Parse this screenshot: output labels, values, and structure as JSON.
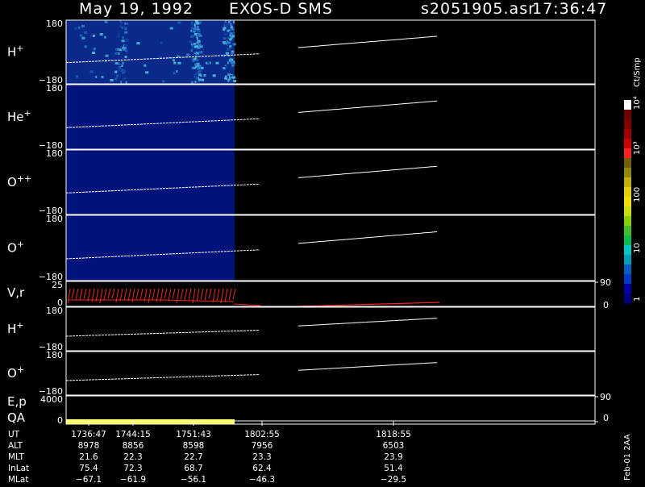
{
  "header": {
    "date": "May 19, 1992",
    "instrument": "EXOS-D SMS",
    "file": "s2051905.asr",
    "time": "17:36:47"
  },
  "colorbar": {
    "unit": "Ct/Smp",
    "tick_labels": [
      "1",
      "10",
      "100",
      "10³",
      "10⁴"
    ],
    "colors": [
      "#000080",
      "#0000a8",
      "#0038c8",
      "#0060c0",
      "#00a0b8",
      "#00c8c8",
      "#00c050",
      "#40c020",
      "#88d000",
      "#c8e000",
      "#f0e000",
      "#e8d000",
      "#c0b000",
      "#908800",
      "#706000",
      "#ff2020",
      "#d00000",
      "#a00000",
      "#800000",
      "#700000",
      "#ffffff"
    ]
  },
  "chart_data": {
    "type": "heatmap",
    "panels": [
      {
        "name": "H",
        "sup": "+",
        "ytop": "180",
        "ybot": "−180",
        "kind": "spectrogram"
      },
      {
        "name": "He",
        "sup": "+",
        "ytop": "180",
        "ybot": "−180",
        "kind": "spectrogram"
      },
      {
        "name": "O",
        "sup": "++",
        "ytop": "180",
        "ybot": "−180",
        "kind": "spectrogram"
      },
      {
        "name": "O",
        "sup": "+",
        "ytop": "180",
        "ybot": "−180",
        "kind": "spectrogram"
      },
      {
        "name": "V,r",
        "sup": "",
        "ytop": "25",
        "ybot": "0",
        "right_top": "90",
        "right_bot": "0",
        "kind": "vr"
      },
      {
        "name": "H",
        "sup": "+",
        "ytop": "180",
        "ybot": "−180",
        "kind": "line"
      },
      {
        "name": "O",
        "sup": "+",
        "ytop": "180",
        "ybot": "−180",
        "kind": "line"
      },
      {
        "name": "E,p",
        "sup": "",
        "ytop": "4000",
        "ybot": "",
        "right_top": "90",
        "kind": "ep"
      },
      {
        "name": "QA",
        "sup": "",
        "ytop": "",
        "ybot": "0",
        "right_bot": "0",
        "kind": "qa"
      }
    ],
    "data_coverage": {
      "start": "17:36:47",
      "end": "17:58:00"
    },
    "trace_segments": [
      {
        "start_frac": 0.0,
        "end_frac": 0.52,
        "angle_start": -60,
        "angle_end": -10
      },
      {
        "start_frac": 0.64,
        "end_frac": 1.0,
        "angle_start": 25,
        "angle_end": 90
      }
    ],
    "footer": {
      "labels": [
        "UT",
        "ALT",
        "MLT",
        "InLat",
        "MLat"
      ],
      "columns": [
        [
          "1736:47",
          "8978",
          "21.6",
          "75.4",
          "−67.1"
        ],
        [
          "1744:15",
          "8856",
          "22.3",
          "72.3",
          "−61.9"
        ],
        [
          "1751:43",
          "8598",
          "22.7",
          "68.7",
          "−56.1"
        ],
        [
          "1802:55",
          "7956",
          "23.3",
          "62.4",
          "−46.3"
        ],
        [
          "1818:55",
          "6503",
          "23.9",
          "51.4",
          "−29.5"
        ]
      ]
    },
    "stamp": "Feb-01 2AA"
  }
}
